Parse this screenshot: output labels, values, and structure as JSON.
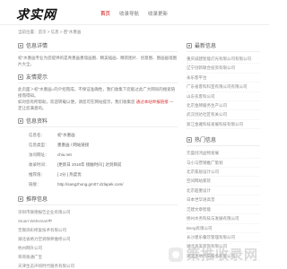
{
  "header": {
    "logo": "求实网",
    "nav": [
      "首页",
      "收录导航",
      "收录更新"
    ]
  },
  "breadcrumb": "当前位置：首页 > 信息 > 密\"水墨画",
  "sections": {
    "intro_title": "信息详情",
    "intro_text": "初\"水墨画专业为您提供的是青墨画墨墙画图、精美插画、精装图片、创意图、图画画墙图片大全。",
    "gen_title": "友情提示",
    "gen_text_a": "此页面＞初\"水墨画=的介绍而成，不保证准确性，我们收集下您能过此广大网同的搜索链接而得知。",
    "gen_text_b": "如对您有所帮助，欢迎转载以便。请您可在网站提示，我们收集您",
    "gen_text_c": "通过本站举报链接",
    "gen_text_d": "一定让您满意的。",
    "info_title": "信息资料",
    "info_rows": [
      {
        "k": "信息名：",
        "v": "初\"水墨画"
      },
      {
        "k": "信息类型：",
        "v": "墨墨画 / 网站链接"
      },
      {
        "k": "访问网址：",
        "v": "chiu.net"
      },
      {
        "k": "收录时间：",
        "v": "[更新日 2018年 接触时间 ] 达到目前"
      },
      {
        "k": "推荐值：",
        "v": "[ 2分 ] 热度优"
      },
      {
        "k": "链接：",
        "v": "http://sangzhong.gm07.dzlapek.com/"
      }
    ],
    "rec_title": "推荐信息",
    "rec_items": [
      "深圳市联德报告企业有限公司",
      "Stuart Websmart中",
      "无锡添彩修复技术有限公司",
      "湖北省格力空调保养维修公司",
      "杭州网升公司",
      "哥哥收通广宝",
      "天津生态声响时代服务有限公司"
    ]
  },
  "side": {
    "latest_title": "最新信息",
    "latest_items": [
      "重庆诚建智能灯光有限公司有限公司",
      "辽宁创新联合投资有限公司",
      "永乐客平台",
      "广东省客科科室有限公司有限公司",
      "山东农客科公司",
      "北京金牌服务生产公司",
      "武汉创达社区有关公司",
      "浙江金雅科技发展科技有限公司"
    ],
    "hot_title": "热门信息",
    "hot_items": [
      "元盛创鸿益物发展",
      "马小马营销推广策划",
      "北京家居设计公司",
      "空间网站家装",
      "北京超墨设计",
      "日本世华语高音",
      "泛建文章智能",
      "扬州水务科技与发展有限公司",
      "Beng有限公司",
      "长沙建乐餐饮管理有限公司",
      "湖北高美装饰有限公司",
      "湖北大地汽车服务有限公司"
    ]
  },
  "watermark": "策推收录网",
  "colors": {
    "accent": "#cc0000",
    "text": "#777777"
  }
}
